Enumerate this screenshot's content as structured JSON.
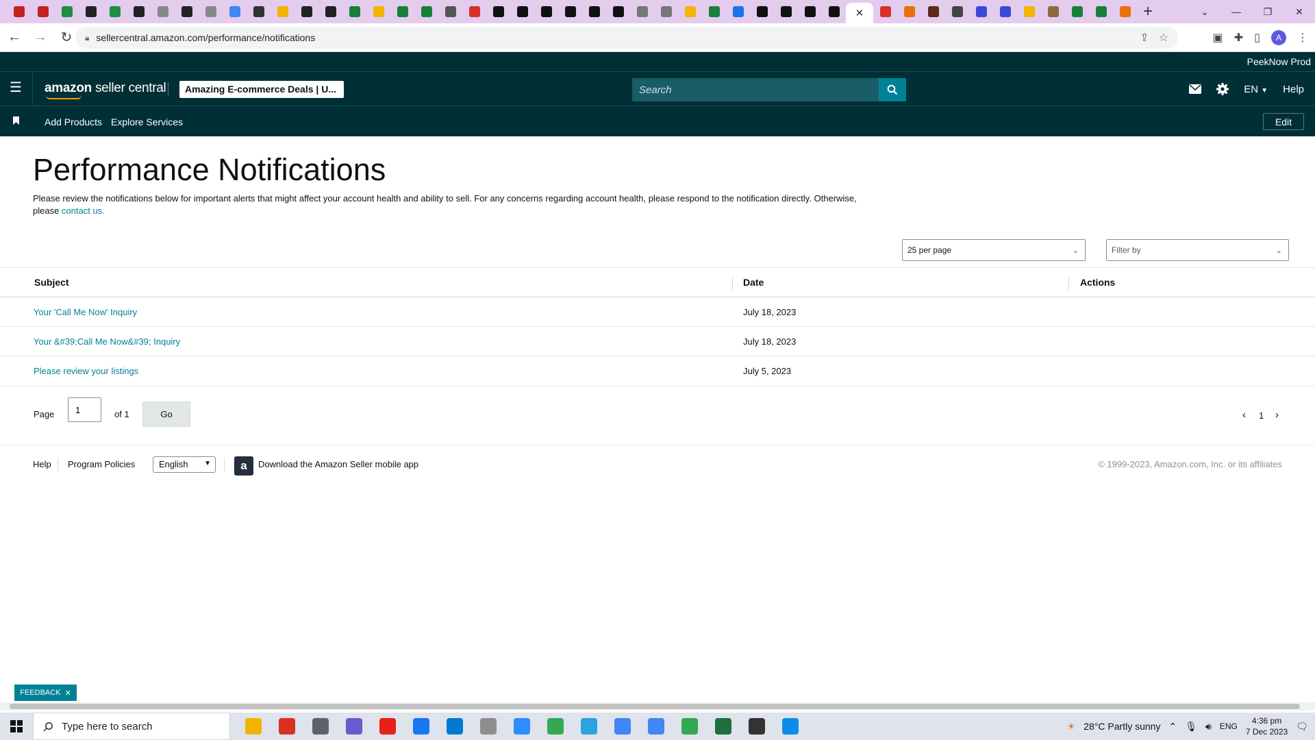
{
  "browser": {
    "url": "sellercentral.amazon.com/performance/notifications",
    "profile_initial": "A",
    "close_tab": "✕",
    "new_tab": "+"
  },
  "header": {
    "account_name": "PeekNow Prod",
    "logo_amazon": "amazon",
    "logo_product": "seller central",
    "store_label": "Amazing E-commerce Deals | U...",
    "search_placeholder": "Search",
    "language": "EN",
    "help": "Help"
  },
  "subnav": {
    "items": [
      "Add Products",
      "Explore Services"
    ],
    "edit_label": "Edit"
  },
  "page": {
    "title": "Performance Notifications",
    "intro_text": "Please review the notifications below for important alerts that might affect your account health and ability to sell. For any concerns regarding account health, please respond to the notification directly. Otherwise, please ",
    "intro_link": "contact us.",
    "per_page": "25 per page",
    "filter_placeholder": "Filter by"
  },
  "table": {
    "columns": [
      "Subject",
      "Date",
      "Actions"
    ],
    "rows": [
      {
        "subject": "Your 'Call Me Now' Inquiry",
        "date": "July 18, 2023"
      },
      {
        "subject": "Your &#39;Call Me Now&#39; Inquiry",
        "date": "July 18, 2023"
      },
      {
        "subject": "Please review your listings",
        "date": "July 5, 2023"
      }
    ]
  },
  "pagination": {
    "page_label": "Page",
    "current_page": "1",
    "of_label": "of 1",
    "go_label": "Go",
    "page_number": "1"
  },
  "footer": {
    "help": "Help",
    "program_policies": "Program Policies",
    "language": "English",
    "app_link": "Download the Amazon Seller mobile app",
    "copyright": "© 1999-2023, Amazon.com, Inc. or its affiliates"
  },
  "feedback": {
    "label": "FEEDBACK",
    "close": "✕"
  },
  "taskbar": {
    "search_placeholder": "Type here to search",
    "weather": "28°C  Partly sunny",
    "input_lang": "ENG",
    "time": "4:36 pm",
    "date": "7 Dec 2023"
  },
  "colors": {
    "nav_bg": "#002f36",
    "accent": "#008296",
    "tabstrip": "#e3ccee"
  }
}
